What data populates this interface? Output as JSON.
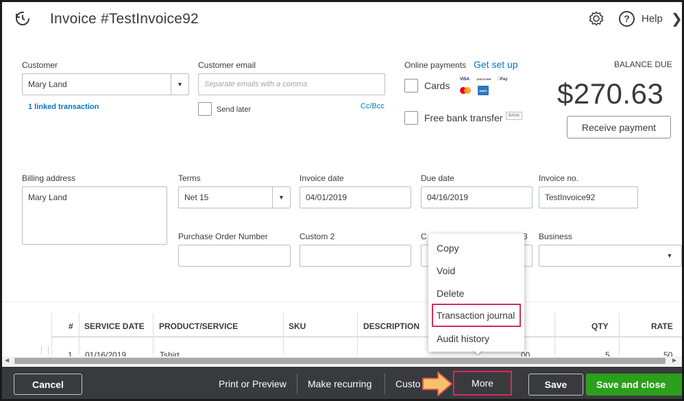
{
  "header": {
    "title": "Invoice #TestInvoice92",
    "help_label": "Help"
  },
  "customer": {
    "label": "Customer",
    "value": "Mary Land",
    "linked": "1 linked transaction"
  },
  "email": {
    "label": "Customer email",
    "placeholder": "Separate emails with a comma",
    "send_later": "Send later",
    "cc_bcc": "Cc/Bcc"
  },
  "payments": {
    "label": "Online payments",
    "get_set_up": "Get set up",
    "cards": "Cards",
    "bank_transfer": "Free bank transfer",
    "bank_badge": "BANK",
    "card_logos": [
      "VISA",
      "DISCOVER",
      "Pay",
      "MC",
      "AMEX"
    ]
  },
  "balance": {
    "label": "BALANCE DUE",
    "amount": "$270.63",
    "receive_payment": "Receive payment"
  },
  "billing": {
    "label": "Billing address",
    "value": "Mary Land"
  },
  "terms": {
    "label": "Terms",
    "value": "Net 15"
  },
  "invoice_date": {
    "label": "Invoice date",
    "value": "04/01/2019"
  },
  "due_date": {
    "label": "Due date",
    "value": "04/16/2019"
  },
  "invoice_no": {
    "label": "Invoice no.",
    "value": "TestInvoice92"
  },
  "po_number": {
    "label": "Purchase Order Number"
  },
  "custom2": {
    "label": "Custom 2"
  },
  "custom3": {
    "label_partial_left": "C",
    "label_partial_right": "3"
  },
  "business": {
    "label": "Business"
  },
  "table": {
    "headers": [
      "#",
      "SERVICE DATE",
      "PRODUCT/SERVICE",
      "SKU",
      "DESCRIPTION",
      "QTY",
      "RATE"
    ],
    "row": {
      "num": "1",
      "service_date": "01/16/2019",
      "product": "Tshirt",
      "amount_partial": "00",
      "qty": "5",
      "rate": "50"
    }
  },
  "more_menu": {
    "items": [
      "Copy",
      "Void",
      "Delete",
      "Transaction journal",
      "Audit history"
    ],
    "highlighted_index": 3,
    "highlight_color": "#d52b5a"
  },
  "footer": {
    "cancel": "Cancel",
    "print_preview": "Print or Preview",
    "make_recurring": "Make recurring",
    "customize_partial": "Custo",
    "more": "More",
    "save": "Save",
    "save_and_close": "Save and close",
    "accent_green": "#2ca01c",
    "arrow_color": "#f5c26b"
  }
}
